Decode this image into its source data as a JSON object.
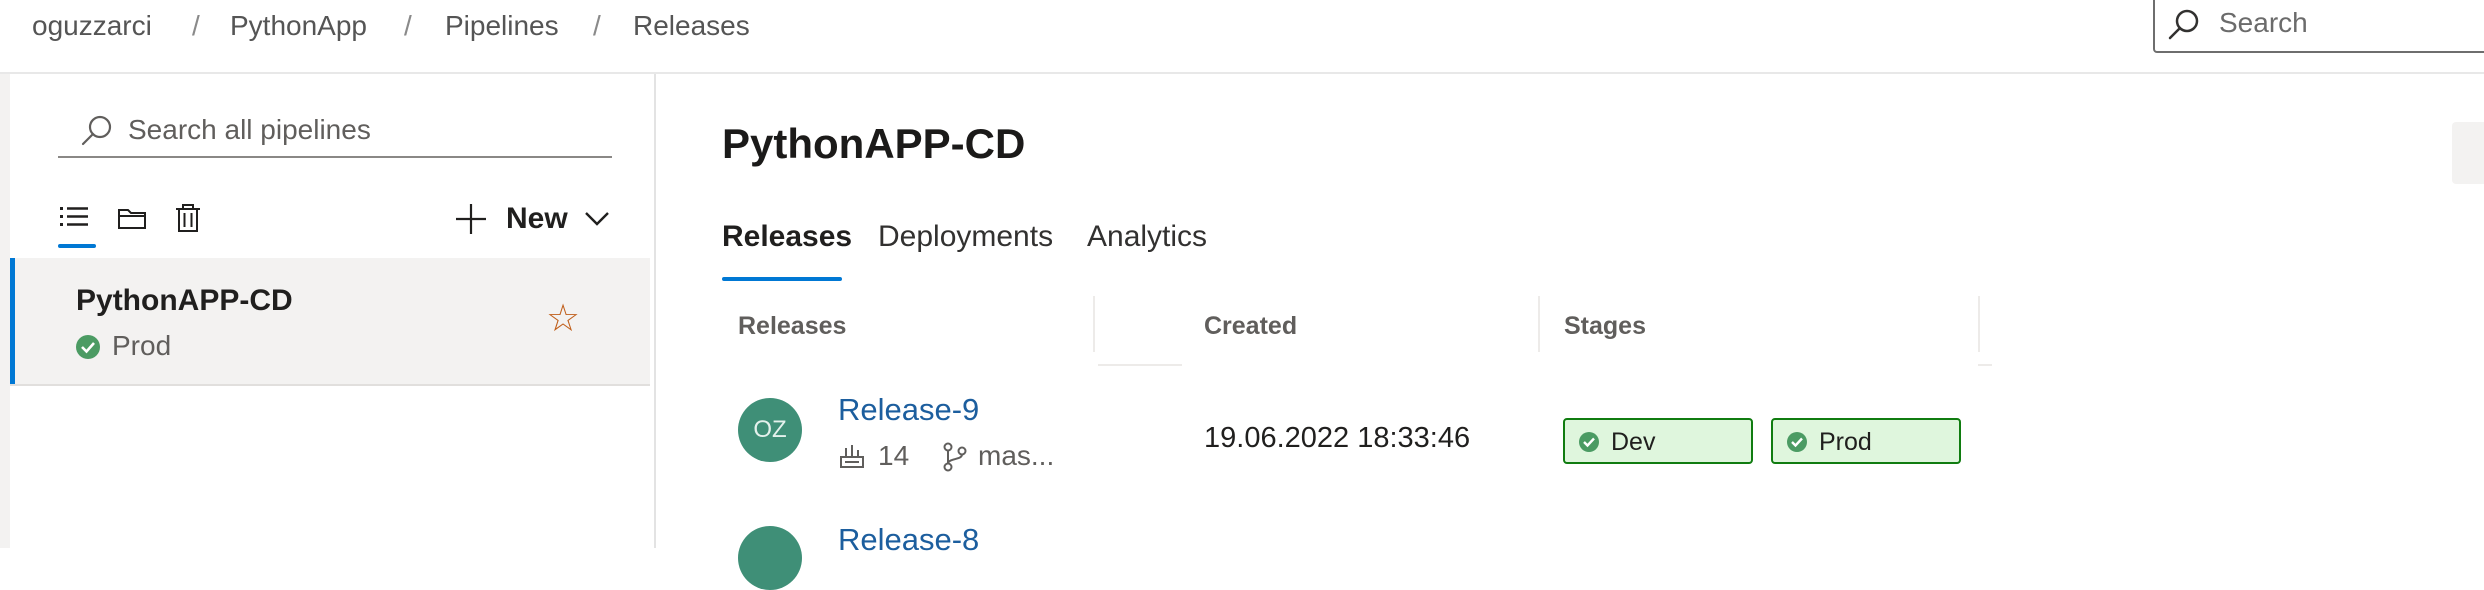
{
  "breadcrumb": {
    "items": [
      "oguzzarci",
      "PythonApp",
      "Pipelines",
      "Releases"
    ],
    "separator": "/"
  },
  "top_search": {
    "placeholder": "Search"
  },
  "left_pane": {
    "search_placeholder": "Search all pipelines",
    "toolbar": {
      "icons": [
        "list-view-icon",
        "folder-view-icon",
        "trash-icon"
      ],
      "new_label": "New"
    },
    "pipeline": {
      "name": "PythonAPP-CD",
      "status": "Prod",
      "status_color": "#4b9b63",
      "favorite": false
    }
  },
  "main": {
    "title": "PythonAPP-CD",
    "tabs": [
      {
        "label": "Releases",
        "active": true
      },
      {
        "label": "Deployments",
        "active": false
      },
      {
        "label": "Analytics",
        "active": false
      }
    ],
    "columns": [
      "Releases",
      "Created",
      "Stages"
    ],
    "releases": [
      {
        "avatar_initials": "OZ",
        "name": "Release-9",
        "build": "14",
        "branch": "mas...",
        "created": "19.06.2022 18:33:46",
        "stages": [
          {
            "name": "Dev",
            "status": "succeeded"
          },
          {
            "name": "Prod",
            "status": "succeeded"
          }
        ]
      },
      {
        "name": "Release-8"
      }
    ]
  },
  "colors": {
    "accent": "#0078d4",
    "link": "#1c5e9e",
    "success_bg": "#dff6dd",
    "success_border": "#107c10",
    "avatar_bg": "#3f8f77",
    "star": "#c05f1b"
  }
}
